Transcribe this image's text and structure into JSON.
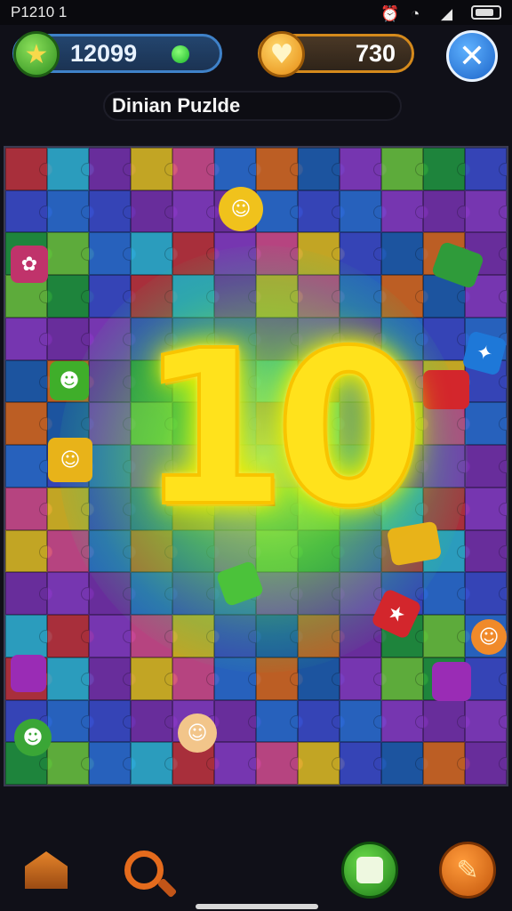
{
  "status": {
    "time": "P1210 1"
  },
  "hud": {
    "coins": "12099",
    "hearts": "730",
    "title": "Dinian Puzlde"
  },
  "level": {
    "number": "10"
  },
  "colors": {
    "board": [
      "#c8323a",
      "#2a6fd8",
      "#1f9a3c",
      "#e7c21f",
      "#8b3ac9",
      "#2fb7d9",
      "#e06b1e",
      "#3b4bd0",
      "#d94b8f",
      "#6cc93a",
      "#7a2fb0",
      "#1d5fb5"
    ],
    "glow": "#ffe21c",
    "coins_accent": "#3f82c9",
    "hearts_accent": "#d58a1c"
  },
  "icons": {
    "coins": "star-icon",
    "hearts": "heart-icon",
    "close": "close-icon",
    "home": "home-icon",
    "hint": "magnifier-icon",
    "shuffle": "shuffle-icon",
    "tools": "hammer-icon"
  }
}
